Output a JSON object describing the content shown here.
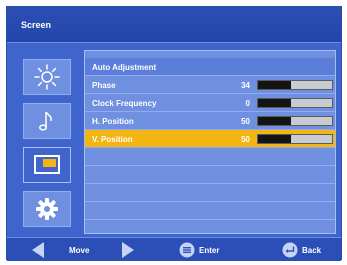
{
  "window": {
    "title": "Screen"
  },
  "sidebar": {
    "items": [
      {
        "icon": "brightness-sun-icon",
        "selected": false
      },
      {
        "icon": "music-note-icon",
        "selected": false
      },
      {
        "icon": "screen-icon",
        "selected": true
      },
      {
        "icon": "settings-gear-icon",
        "selected": false
      }
    ]
  },
  "menu": {
    "header": "Auto Adjustment",
    "rows": [
      {
        "label": "Phase",
        "value": "34",
        "level": 0.45
      },
      {
        "label": "Clock Frequency",
        "value": "0",
        "level": 0.44
      },
      {
        "label": "H. Position",
        "value": "50",
        "level": 0.45
      },
      {
        "label": "V. Position",
        "value": "50",
        "level": 0.45,
        "selected": true
      }
    ]
  },
  "footer": {
    "move_label": "Move",
    "enter_label": "Enter",
    "back_label": "Back"
  },
  "colors": {
    "osd_background": "#3f64cc",
    "panel_background": "#6f8fe0",
    "selected_row": "#f2b512",
    "bar_fill": "#141414",
    "bar_track": "#c8cbd2"
  }
}
